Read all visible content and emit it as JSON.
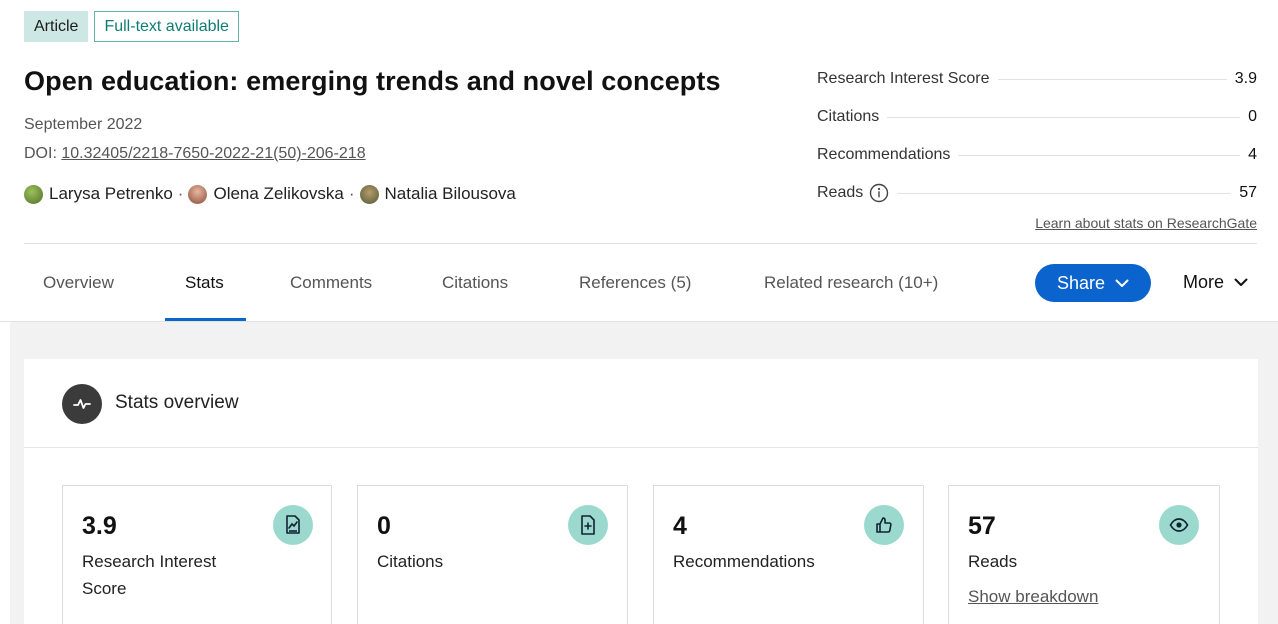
{
  "badges": {
    "type": "Article",
    "fulltext": "Full-text available"
  },
  "publication": {
    "title": "Open education: emerging trends and novel concepts",
    "date": "September 2022",
    "doi_label": "DOI:",
    "doi_value": "10.32405/2218-7650-2022-21(50)-206-218"
  },
  "authors": [
    {
      "name": "Larysa Petrenko",
      "avatar_color": "#6b8f3a"
    },
    {
      "name": "Olena Zelikovska",
      "avatar_color": "#b0644a"
    },
    {
      "name": "Natalia Bilousova",
      "avatar_color": "#5c6b3f"
    }
  ],
  "author_separator": "·",
  "side_stats": [
    {
      "label": "Research Interest Score",
      "value": "3.9"
    },
    {
      "label": "Citations",
      "value": "0"
    },
    {
      "label": "Recommendations",
      "value": "4"
    },
    {
      "label": "Reads",
      "value": "57",
      "icon": "info-icon"
    }
  ],
  "learn_link": "Learn about stats on ResearchGate",
  "tabs": [
    {
      "label": "Overview"
    },
    {
      "label": "Stats",
      "active": true
    },
    {
      "label": "Comments"
    },
    {
      "label": "Citations"
    },
    {
      "label": "References (5)"
    },
    {
      "label": "Related research (10+)"
    }
  ],
  "share_label": "Share",
  "more_label": "More",
  "panel_title": "Stats overview",
  "cards": [
    {
      "value": "3.9",
      "label": "Research Interest Score",
      "icon": "research-score-icon"
    },
    {
      "value": "0",
      "label": "Citations",
      "icon": "citation-document-icon"
    },
    {
      "value": "4",
      "label": "Recommendations",
      "icon": "thumbs-up-icon"
    },
    {
      "value": "57",
      "label": "Reads",
      "icon": "eye-icon",
      "link": "Show breakdown"
    }
  ],
  "colors": {
    "accent_blue": "#0b63ce",
    "teal_icon_bg": "#9bd9cf",
    "badge_fill": "#cde7e4",
    "badge_border": "#65b3ad"
  }
}
